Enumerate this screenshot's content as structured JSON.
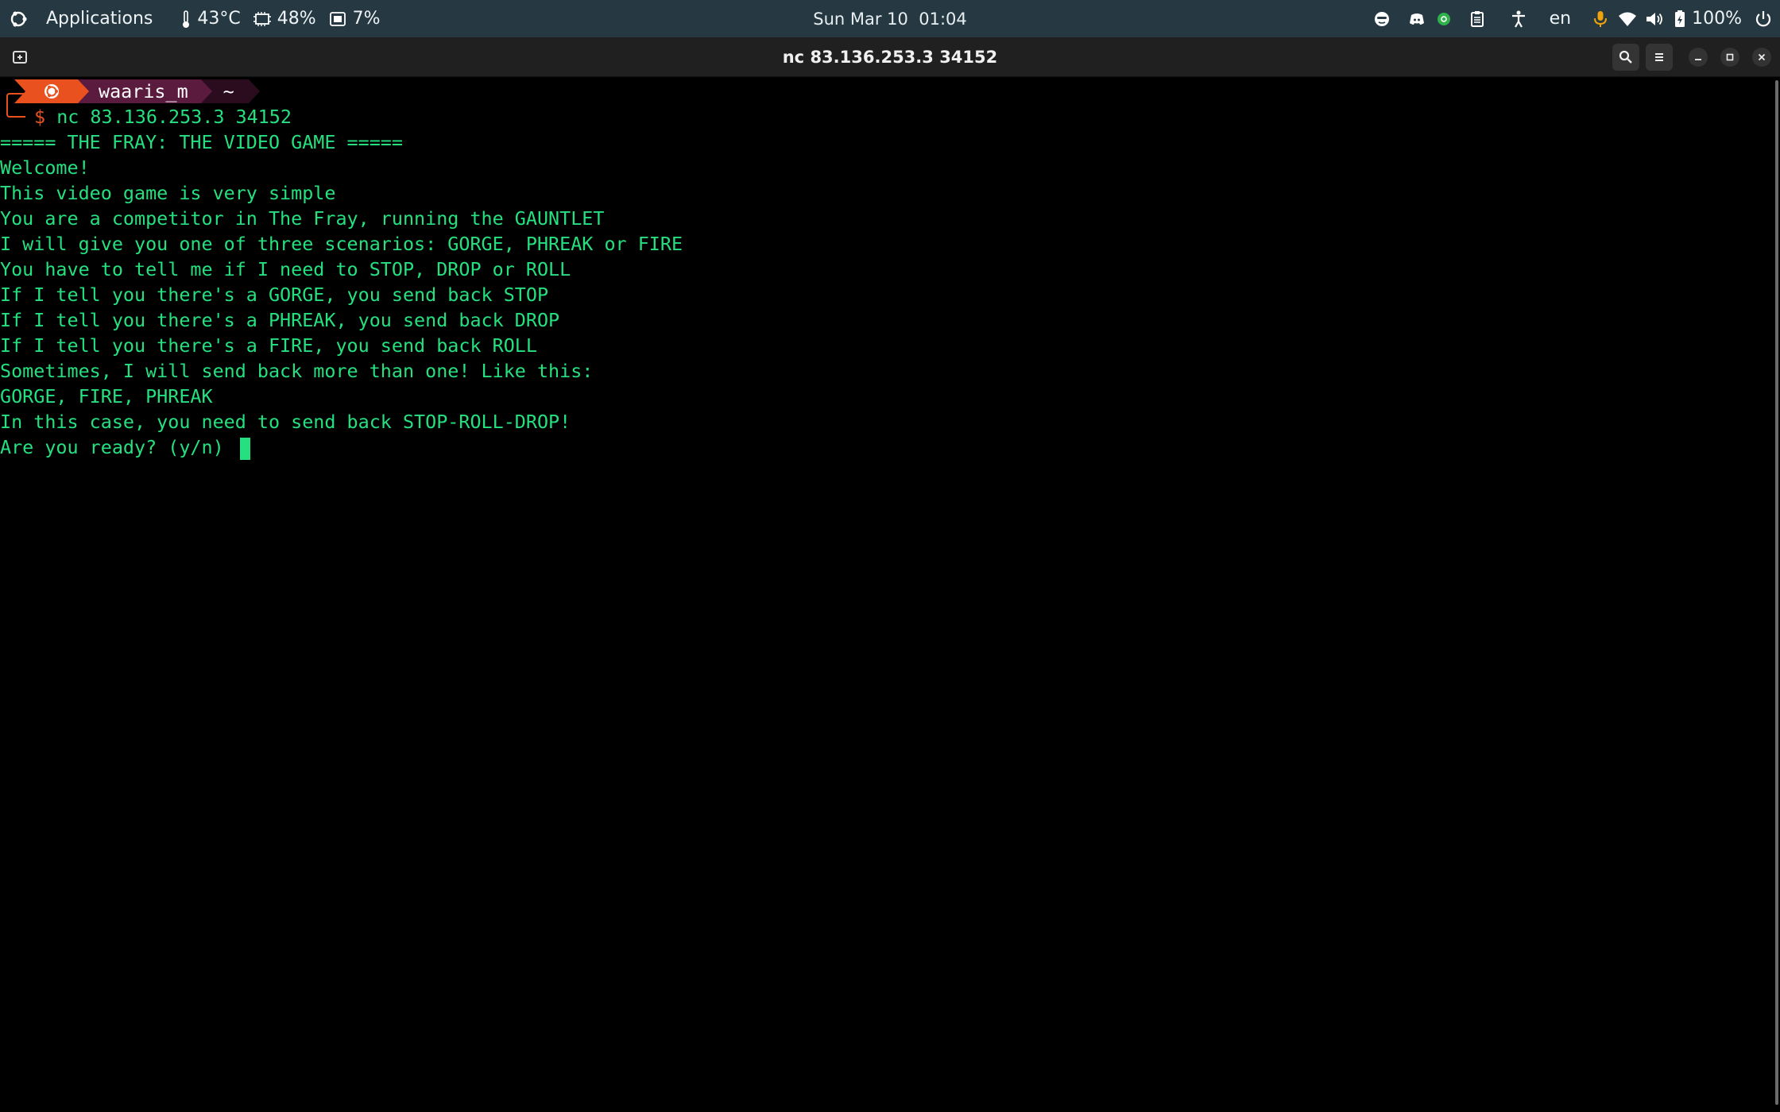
{
  "topbar": {
    "applications_label": "Applications",
    "temperature": "43°C",
    "cpu": "48%",
    "memory": "7%",
    "clock": "Sun Mar 10  01:04",
    "language": "en",
    "battery": "100%"
  },
  "window": {
    "title": "nc 83.136.253.3 34152"
  },
  "terminal": {
    "prompt_user": "waaris_m",
    "prompt_dir": "~",
    "prompt_symbol": "$",
    "command": "nc 83.136.253.3 34152",
    "output": [
      "===== THE FRAY: THE VIDEO GAME =====",
      "Welcome!",
      "This video game is very simple",
      "You are a competitor in The Fray, running the GAUNTLET",
      "I will give you one of three scenarios: GORGE, PHREAK or FIRE",
      "You have to tell me if I need to STOP, DROP or ROLL",
      "If I tell you there's a GORGE, you send back STOP",
      "If I tell you there's a PHREAK, you send back DROP",
      "If I tell you there's a FIRE, you send back ROLL",
      "Sometimes, I will send back more than one! Like this:",
      "GORGE, FIRE, PHREAK",
      "In this case, you need to send back STOP-ROLL-DROP!",
      "Are you ready? (y/n) "
    ]
  },
  "colors": {
    "panel_bg": "#263943",
    "terminal_text": "#26e07f",
    "prompt_accent": "#e9511f",
    "prompt_user_bg": "#5a1b3f",
    "prompt_dir_bg": "#2b0c1e"
  }
}
